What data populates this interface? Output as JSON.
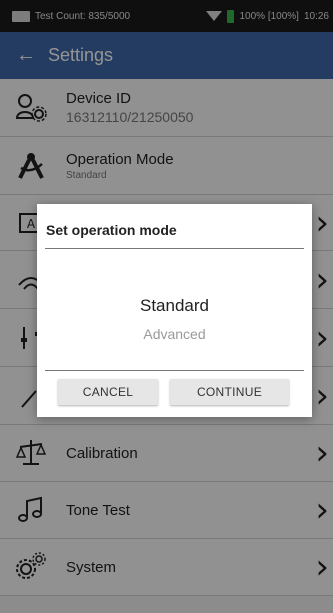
{
  "status_bar": {
    "test_count": "Test Count: 835/5000",
    "battery": "100% [100%]",
    "time": "10:26"
  },
  "app_bar": {
    "back_icon": "arrow-left-icon",
    "title": "Settings"
  },
  "settings": [
    {
      "icon": "users-gear-icon",
      "label": "Device ID",
      "value": "16312110/21250050"
    },
    {
      "icon": "compass-icon",
      "label": "Operation Mode",
      "value": "Standard"
    },
    {
      "icon": "text-box-icon",
      "label": ""
    },
    {
      "icon": "wifi-icon",
      "label": ""
    },
    {
      "icon": "sliders-icon",
      "label": ""
    },
    {
      "icon": "wand-icon",
      "label": ""
    },
    {
      "icon": "balance-icon",
      "label": "Calibration"
    },
    {
      "icon": "music-note-icon",
      "label": "Tone Test"
    },
    {
      "icon": "gears-icon",
      "label": "System"
    }
  ],
  "dialog": {
    "title": "Set operation mode",
    "options": [
      "Standard",
      "Advanced"
    ],
    "selected": "Standard",
    "cancel_label": "CANCEL",
    "continue_label": "CONTINUE"
  }
}
